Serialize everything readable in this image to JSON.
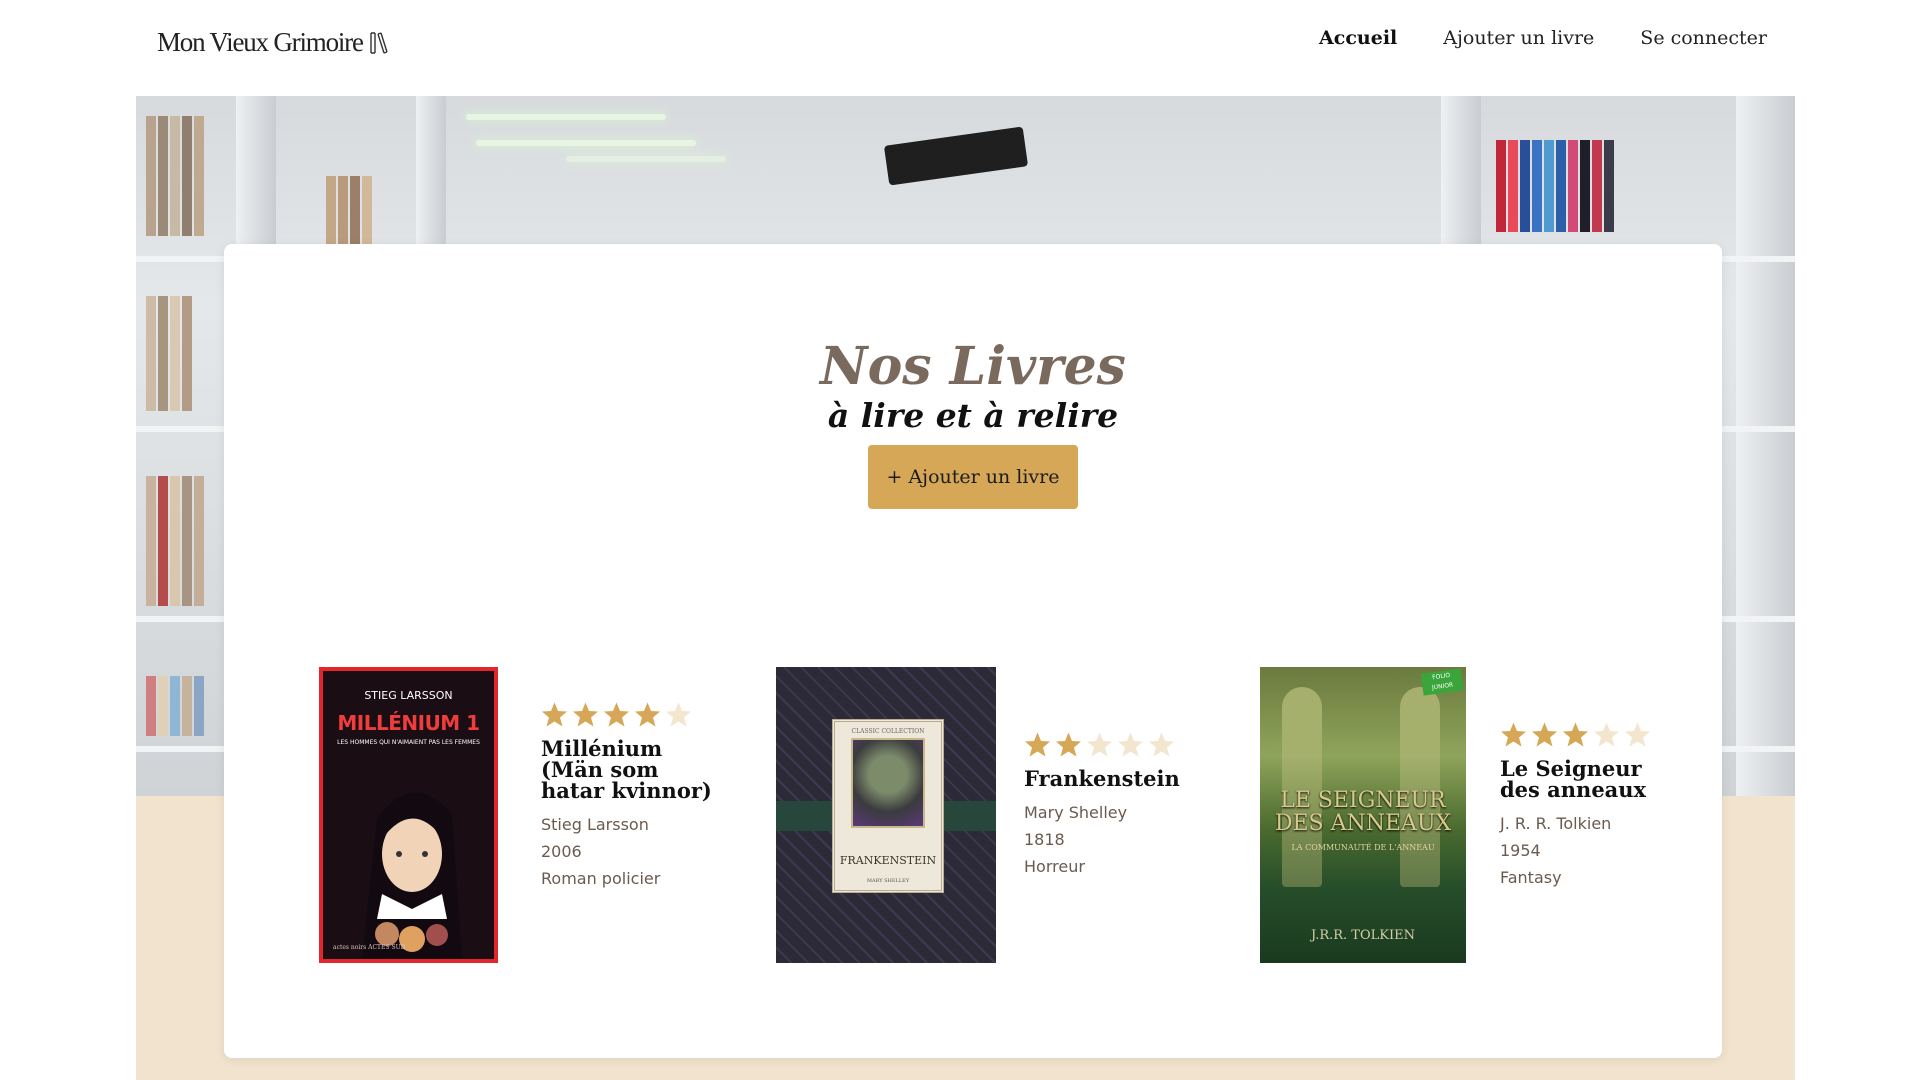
{
  "brand": {
    "name": "Mon Vieux Grimoire"
  },
  "nav": {
    "home": "Accueil",
    "add_book": "Ajouter un livre",
    "login": "Se connecter"
  },
  "hero": {
    "title": "Nos Livres",
    "subtitle": "à lire et à relire",
    "add_button": "+ Ajouter un livre"
  },
  "colors": {
    "accent": "#d6a756",
    "title": "#7a6a5e",
    "meta": "#6b5a4e",
    "beige": "#f1e3cd",
    "star_on": "#d6a756",
    "star_off": "#f3e6cf"
  },
  "books": [
    {
      "title": "Millénium (Män som hatar kvinnor)",
      "author": "Stieg Larsson",
      "year": "2006",
      "genre": "Roman policier",
      "rating": 4,
      "cover": {
        "author": "STIEG LARSSON",
        "title": "MILLÉNIUM 1",
        "subtitle": "LES HOMMES QUI N'AIMAIENT PAS LES FEMMES",
        "publisher": "actes noirs ACTES SUD"
      }
    },
    {
      "title": "Frankenstein",
      "author": "Mary Shelley",
      "year": "1818",
      "genre": "Horreur",
      "rating": 2,
      "cover": {
        "series": "CLASSIC COLLECTION",
        "title": "FRANKENSTEIN",
        "author": "MARY SHELLEY"
      }
    },
    {
      "title": "Le Seigneur des anneaux",
      "author": "J. R. R. Tolkien",
      "year": "1954",
      "genre": "Fantasy",
      "rating": 3,
      "cover": {
        "badge": "FOLIO JUNIOR",
        "title_line1": "LE SEIGNEUR",
        "title_line2": "DES ANNEAUX",
        "subtitle": "LA COMMUNAUTÉ DE L'ANNEAU",
        "author": "J.R.R. TOLKIEN"
      }
    }
  ]
}
